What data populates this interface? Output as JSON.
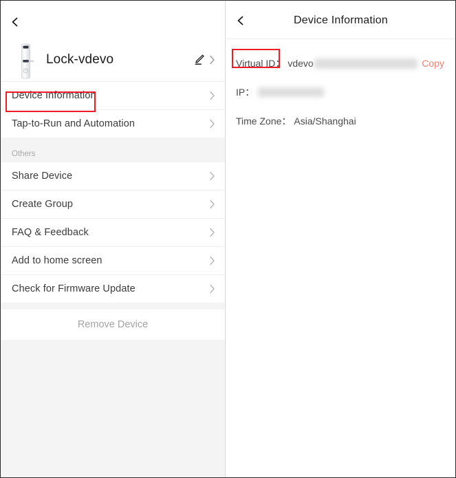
{
  "left_panel": {
    "back_icon": "back-chevron-icon",
    "device": {
      "icon": "smart-lock-icon",
      "name": "Lock-vdevo",
      "edit_icon": "pencil-edit-icon",
      "edit_chevron_icon": "chevron-right-icon"
    },
    "primary_menu": [
      {
        "label": "Device Information",
        "chevron": "chevron-right-icon"
      },
      {
        "label": "Tap-to-Run and Automation",
        "chevron": "chevron-right-icon"
      }
    ],
    "section_header": "Others",
    "others_menu": [
      {
        "label": "Share Device",
        "chevron": "chevron-right-icon"
      },
      {
        "label": "Create Group",
        "chevron": "chevron-right-icon"
      },
      {
        "label": "FAQ & Feedback",
        "chevron": "chevron-right-icon"
      },
      {
        "label": "Add to home screen",
        "chevron": "chevron-right-icon"
      },
      {
        "label": "Check for Firmware Update",
        "chevron": "chevron-right-icon"
      }
    ],
    "remove_label": "Remove Device"
  },
  "right_panel": {
    "back_icon": "back-chevron-icon",
    "title": "Device Information",
    "rows": [
      {
        "label": "Virtual ID：",
        "value": "vdevo",
        "redacted": true,
        "action": "Copy"
      },
      {
        "label": "IP：",
        "value": "",
        "redacted": true,
        "action": ""
      },
      {
        "label": "Time Zone：",
        "value": "Asia/Shanghai",
        "redacted": false,
        "action": ""
      }
    ]
  },
  "annotations": {
    "color": "#ef1b26",
    "boxes": [
      {
        "target": "Device Information"
      },
      {
        "target": "Virtual ID："
      }
    ]
  },
  "theme": {
    "accent": "#f08070",
    "page_bg": "#f4f4f4",
    "card_bg": "#ffffff",
    "text_primary": "#1c1c1c",
    "text_secondary": "#4a4a4a",
    "text_muted": "#a3a3a3"
  }
}
